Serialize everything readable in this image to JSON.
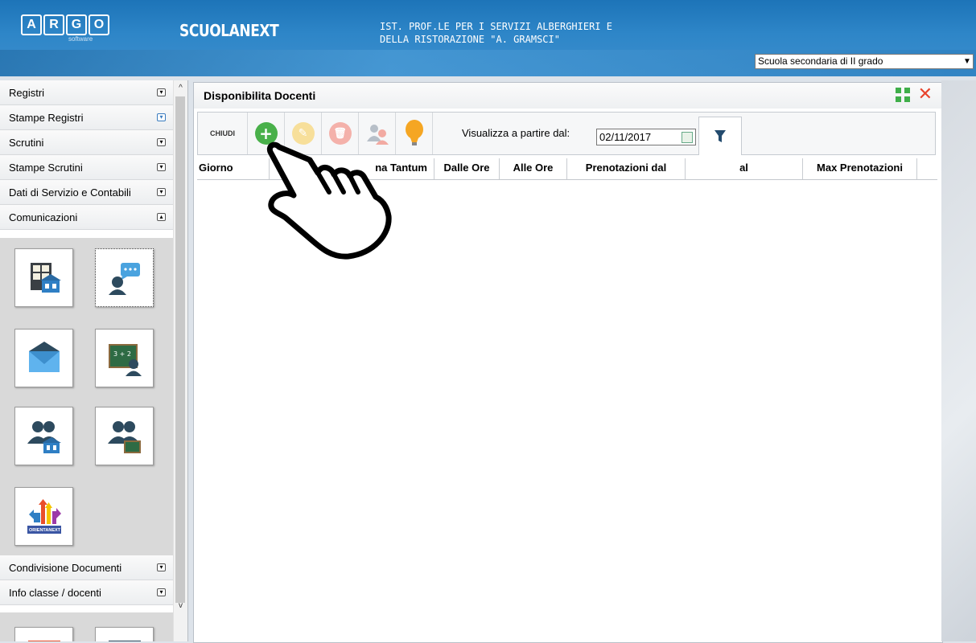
{
  "header": {
    "logo_letters": [
      "A",
      "R",
      "G",
      "O"
    ],
    "logo_sub": "software",
    "app_name": "SCUOLANEXT",
    "school_line1": "IST. PROF.LE PER I SERVIZI ALBERGHIERI E",
    "school_line2": "DELLA RISTORAZIONE \"A. GRAMSCI\"",
    "school_type": "Scuola secondaria di II grado"
  },
  "sidebar": {
    "items": [
      {
        "label": "Registri"
      },
      {
        "label": "Stampe Registri"
      },
      {
        "label": "Scrutini"
      },
      {
        "label": "Stampe Scrutini"
      },
      {
        "label": "Dati di Servizio e Contabili"
      },
      {
        "label": "Comunicazioni"
      }
    ],
    "after_items": [
      {
        "label": "Condivisione Documenti"
      },
      {
        "label": "Info classe / docenti"
      }
    ],
    "tiles": [
      "bacheca-icon",
      "ricevimento-docenti-icon",
      "messaggi-icon",
      "lavagna-icon",
      "genitori-scuola-icon",
      "genitori-classe-icon",
      "orientanext-icon"
    ],
    "orientanext_label": "ORIENTANEXT"
  },
  "panel": {
    "title": "Disponibilita Docenti",
    "toolbar": {
      "close_label": "CHIUDI",
      "date_label": "Visualizza a partire dal:",
      "date_value": "02/11/2017"
    },
    "columns": [
      "Giorno",
      "na Tantum",
      "Dalle Ore",
      "Alle Ore",
      "Prenotazioni dal",
      "al",
      "Max Prenotazioni"
    ]
  },
  "colors": {
    "header_blue": "#2e86c8",
    "add_green": "#49b04a",
    "close_red": "#e8432c",
    "bulb_orange": "#f5a623"
  }
}
